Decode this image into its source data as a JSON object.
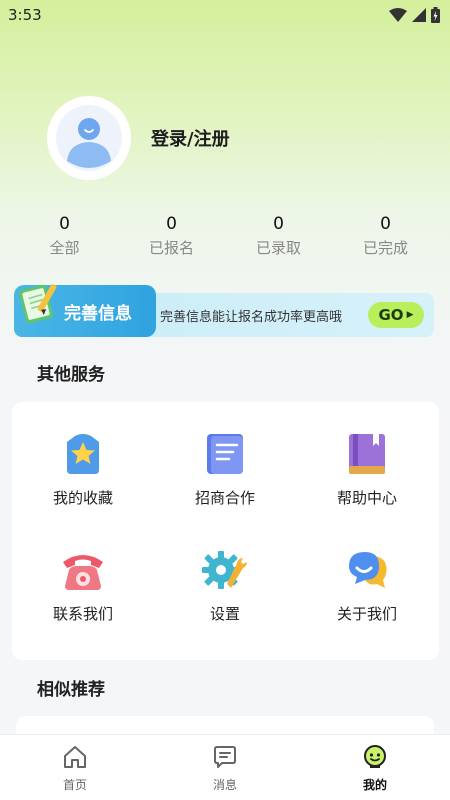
{
  "status": {
    "time": "3:53"
  },
  "profile": {
    "login_label": "登录/注册"
  },
  "stats": [
    {
      "count": "0",
      "label": "全部"
    },
    {
      "count": "0",
      "label": "已报名"
    },
    {
      "count": "0",
      "label": "已录取"
    },
    {
      "count": "0",
      "label": "已完成"
    }
  ],
  "banner": {
    "title": "完善信息",
    "description": "完善信息能让报名成功率更高哦",
    "go_label": "GO"
  },
  "services": {
    "title": "其他服务",
    "items": [
      {
        "label": "我的收藏",
        "icon": "favorites-icon"
      },
      {
        "label": "招商合作",
        "icon": "document-icon"
      },
      {
        "label": "帮助中心",
        "icon": "book-icon"
      },
      {
        "label": "联系我们",
        "icon": "telephone-icon"
      },
      {
        "label": "设置",
        "icon": "gear-icon"
      },
      {
        "label": "关于我们",
        "icon": "chat-bubbles-icon"
      }
    ]
  },
  "recommend": {
    "title": "相似推荐"
  },
  "tabbar": [
    {
      "label": "首页",
      "icon": "home-icon"
    },
    {
      "label": "消息",
      "icon": "message-icon"
    },
    {
      "label": "我的",
      "icon": "profile-face-icon",
      "active": true
    }
  ],
  "colors": {
    "accent_green": "#b8ef5a",
    "banner_blue": "#2fa3e0",
    "icon_blue": "#4a8ef0"
  }
}
